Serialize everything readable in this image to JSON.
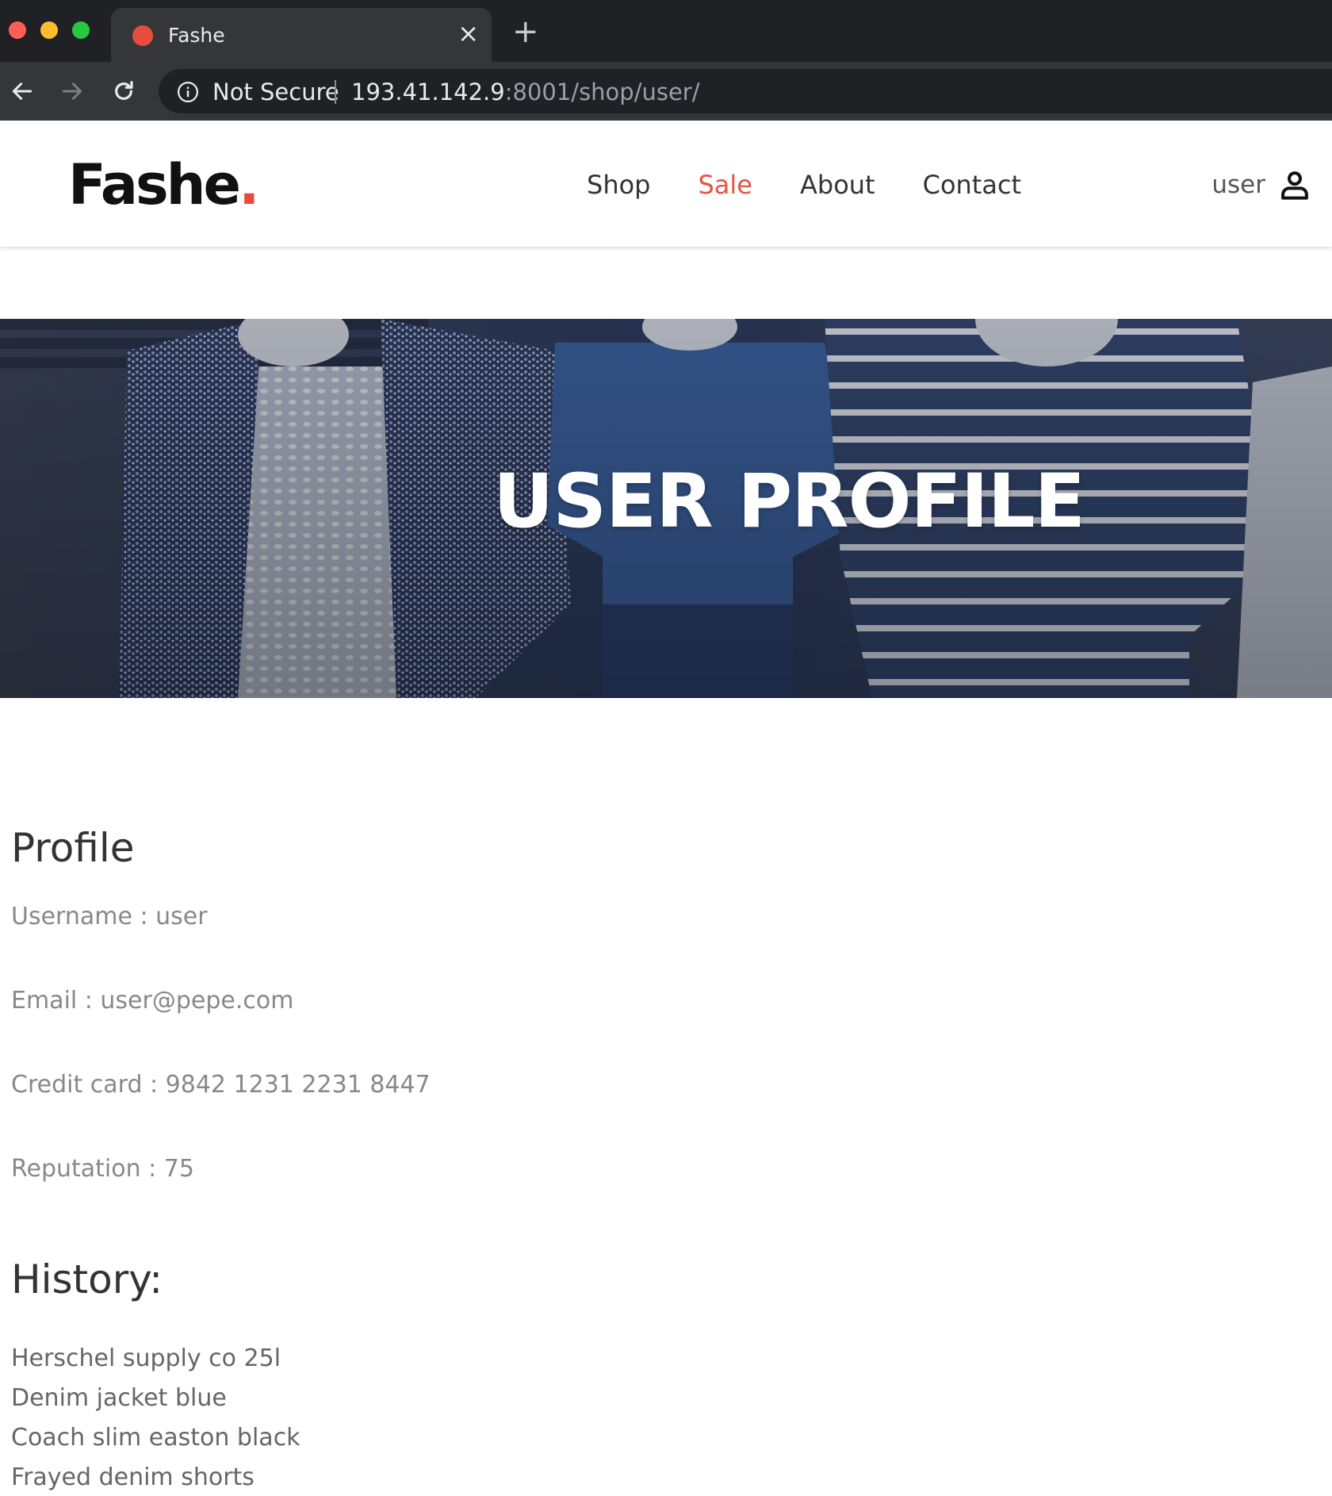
{
  "browser": {
    "tab_title": "Fashe",
    "tab_close_icon": "close-icon",
    "new_tab_icon": "plus-icon",
    "security_label": "Not Secure",
    "url_host": "193.41.142.9",
    "url_rest": ":8001/shop/user/"
  },
  "header": {
    "logo_text": "Fashe",
    "logo_dot": ".",
    "nav": [
      {
        "label": "Shop"
      },
      {
        "label": "Sale"
      },
      {
        "label": "About"
      },
      {
        "label": "Contact"
      }
    ],
    "username": "user",
    "user_icon": "user-icon"
  },
  "hero": {
    "title": "USER PROFILE"
  },
  "profile": {
    "title": "Profile",
    "username_line": "Username : user",
    "email_line": "Email : user@pepe.com",
    "card_line": "Credit card : 9842 1231 2231 8447",
    "reputation_line": "Reputation : 75"
  },
  "history": {
    "title": "History:",
    "items": [
      "Herschel supply co 25l",
      "Denim jacket blue",
      "Coach slim easton black",
      "Frayed denim shorts"
    ]
  },
  "colors": {
    "accent": "#e65540",
    "favicon": "#e84c3d",
    "chrome_dark": "#202124",
    "chrome_tab": "#35363a"
  }
}
